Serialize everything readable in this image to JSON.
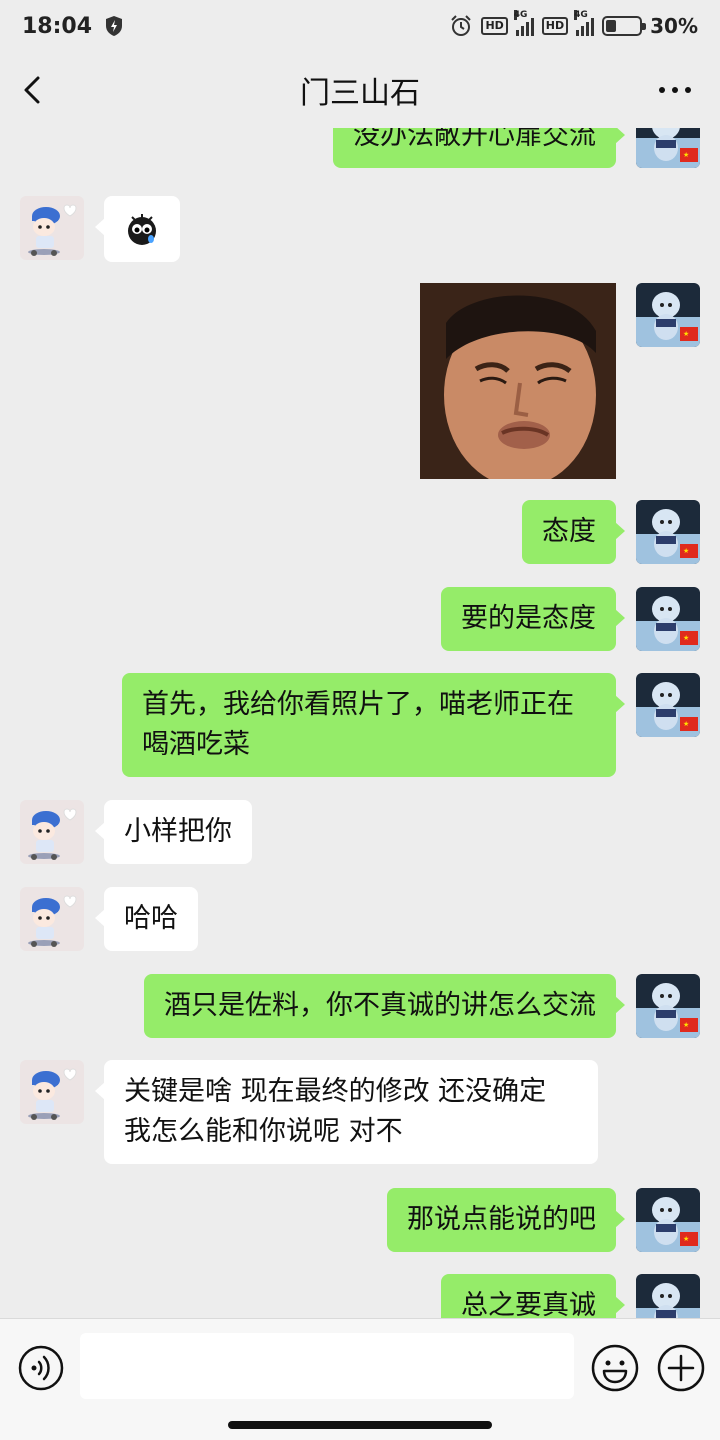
{
  "status_bar": {
    "time": "18:04",
    "hd1": "HD",
    "net1": "4G",
    "hd2": "HD",
    "net2": "4G",
    "battery_level": 0.3,
    "battery_percent": "30%"
  },
  "header": {
    "title": "门三山石"
  },
  "messages": [
    {
      "side": "right",
      "type": "text",
      "text": "没办法敞开心扉交流"
    },
    {
      "side": "left",
      "type": "emoji",
      "emoji_icon": "crying-face-emoji"
    },
    {
      "side": "right",
      "type": "image",
      "image_icon": "man-grimace-meme-photo"
    },
    {
      "side": "right",
      "type": "text",
      "text": "态度"
    },
    {
      "side": "right",
      "type": "text",
      "text": "要的是态度"
    },
    {
      "side": "right",
      "type": "text",
      "text": "首先，我给你看照片了，喵老师正在喝酒吃菜"
    },
    {
      "side": "left",
      "type": "text",
      "text": "小样把你"
    },
    {
      "side": "left",
      "type": "text",
      "text": "哈哈"
    },
    {
      "side": "right",
      "type": "text",
      "text": "酒只是佐料，你不真诚的讲怎么交流"
    },
    {
      "side": "left",
      "type": "text",
      "text": "关键是啥 现在最终的修改 还没确定 我怎么能和你说呢 对不"
    },
    {
      "side": "right",
      "type": "text",
      "text": "那说点能说的吧"
    },
    {
      "side": "right",
      "type": "text",
      "text": "总之要真诚"
    }
  ],
  "colors": {
    "sent_bubble": "#95EC69",
    "received_bubble": "#FFFFFF",
    "background": "#EDEDED"
  },
  "input_bar": {
    "value": "",
    "placeholder": ""
  }
}
